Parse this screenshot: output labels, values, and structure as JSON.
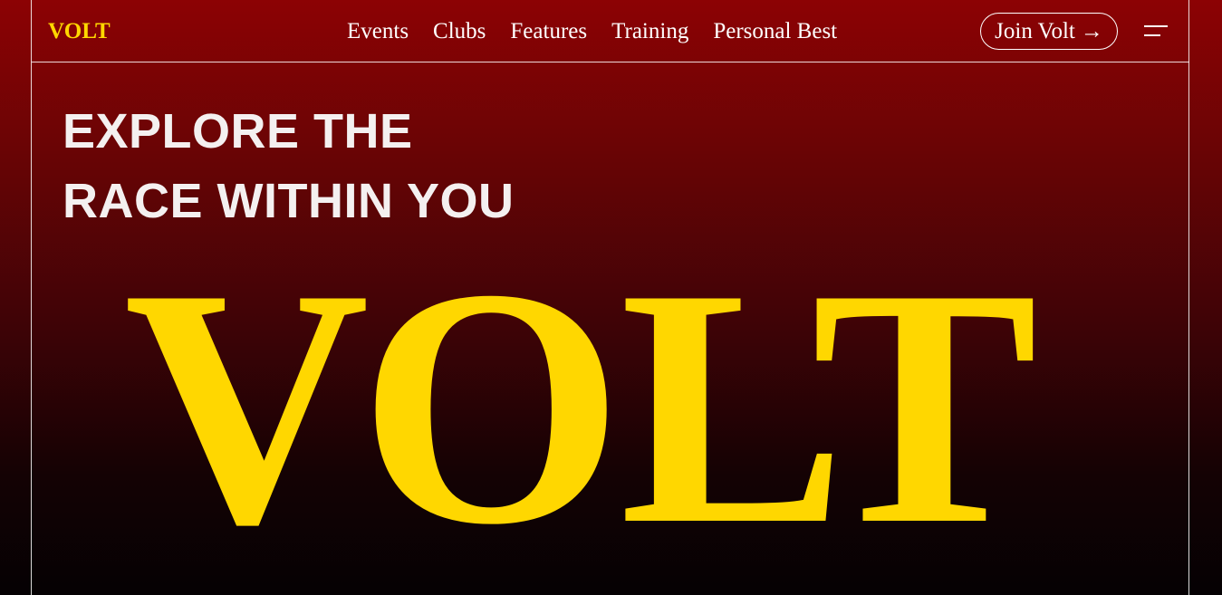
{
  "brand": {
    "logo": "VOLT",
    "accent_color": "#ffd700"
  },
  "nav": {
    "items": [
      {
        "label": "Events"
      },
      {
        "label": "Clubs"
      },
      {
        "label": "Features"
      },
      {
        "label": "Training"
      },
      {
        "label": "Personal Best"
      }
    ],
    "cta_label": "Join Volt",
    "cta_arrow": "→",
    "menu_icon": "hamburger-menu-icon"
  },
  "hero": {
    "headline_line1": "EXPLORE THE",
    "headline_line2": "RACE WITHIN YOU",
    "big_title": "VOLT",
    "background_top": "#8c0204",
    "background_bottom": "#050103"
  }
}
